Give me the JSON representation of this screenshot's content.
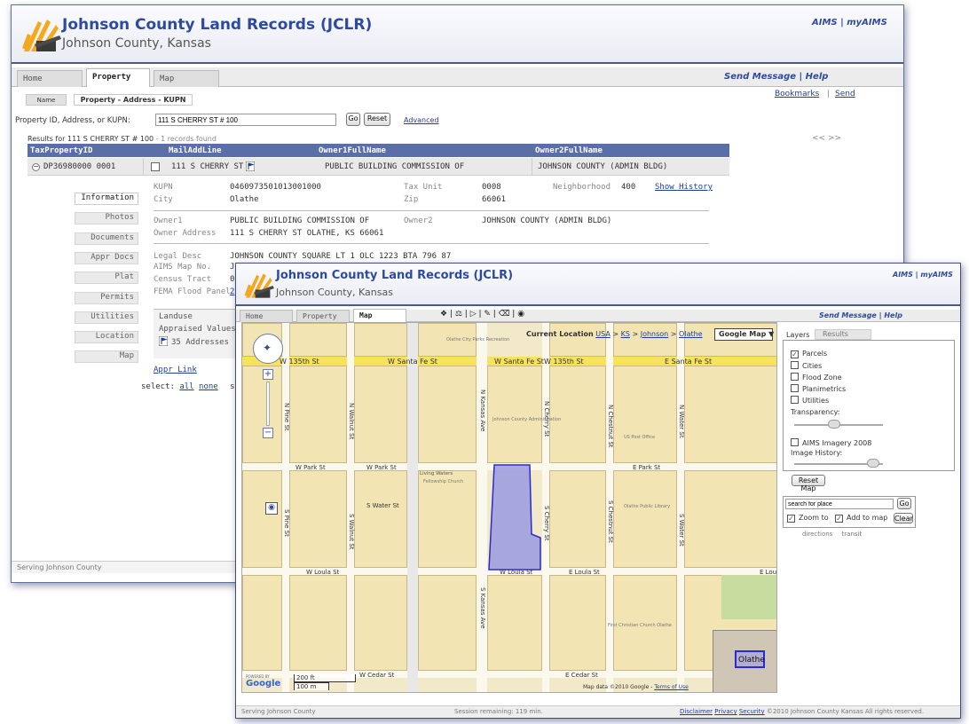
{
  "app": {
    "title": "Johnson County Land Records (JCLR)",
    "subtitle": "Johnson County, Kansas",
    "top_links": "AIMS | myAIMS"
  },
  "back_window": {
    "tabs": [
      "Home",
      "Property",
      "Map"
    ],
    "active_tab": "Property",
    "right_links": "Send Message | Help",
    "bookmarks": "Bookmarks",
    "send": "Send",
    "search_mode_name": "Name",
    "search_mode_active": "Property - Address - KUPN",
    "search_label": "Property ID, Address, or KUPN:",
    "search_value": "111 S CHERRY ST # 100",
    "go_button": "Go",
    "reset_button": "Reset",
    "advanced_link": "Advanced",
    "results_text": "Results for 111 S CHERRY ST # 100",
    "results_count": " - 1 records found",
    "pager": "<< >>",
    "columns": [
      "TaxPropertyID",
      "MailAddLine",
      "Owner1FullName",
      "Owner2FullName"
    ],
    "row": {
      "tax_id": "DP36980000 0001",
      "mail": "111 S CHERRY ST",
      "owner1": "PUBLIC BUILDING COMMISSION OF",
      "owner2": "JOHNSON COUNTY (ADMIN BLDG)"
    },
    "side_tabs": [
      "Information",
      "Photos",
      "Documents",
      "Appr Docs",
      "Plat",
      "Permits",
      "Utilities",
      "Location",
      "Map"
    ],
    "details": {
      "kupn_label": "KUPN",
      "kupn": "0460973501013001000",
      "city_label": "City",
      "city": "Olathe",
      "taxunit_label": "Tax Unit",
      "taxunit": "0008",
      "zip_label": "Zip",
      "zip": "66061",
      "neighborhood_label": "Neighborhood",
      "neighborhood": "400",
      "show_history": "Show History",
      "owner1_label": "Owner1",
      "owner1": "PUBLIC BUILDING COMMISSION OF",
      "owner2_label": "Owner2",
      "owner2": "JOHNSON COUNTY (ADMIN BLDG)",
      "owner_addr_label": "Owner Address",
      "owner_addr": "111 S CHERRY ST  OLATHE, KS 66061",
      "legal_label": "Legal Desc",
      "legal": "JOHNSON COUNTY SQUARE LT 1 OLC 1223 BTA 796 87",
      "aims_label": "AIMS Map No.",
      "aims": "J",
      "census_label": "Census Tract",
      "census": "0",
      "fema_label": "FEMA Flood Panel",
      "fema": "2",
      "landuse": "Landuse",
      "appraised": "Appraised Values",
      "addresses": "35 Addresses",
      "appr_link": "Appr Link",
      "select_label": "select:",
      "select_all": "all",
      "select_none": "none",
      "select_trail": "sel"
    },
    "footer": "Serving Johnson County"
  },
  "front_window": {
    "tabs": [
      "Home",
      "Property",
      "Map"
    ],
    "active_tab": "Map",
    "right_links": "Send Message | Help",
    "toolbar_icons": [
      "info-icon",
      "measure-icon",
      "select-icon",
      "draw-icon",
      "erase-icon",
      "camera-icon"
    ],
    "current_location_label": "Current Location",
    "breadcrumb": [
      "USA",
      "KS",
      "Johnson",
      "Olathe"
    ],
    "map_type": "Google Map ▼",
    "streets": {
      "w135": "W 135th St",
      "santa_fe_1": "W Santa Fe St",
      "santa_fe_2": "W Santa Fe St",
      "w135_2": "W 135th St",
      "e_santa_fe": "E Santa Fe St",
      "w_park_1": "W Park St",
      "w_park_2": "W Park St",
      "e_park": "E Park St",
      "s_water": "S Water St",
      "w_loula_1": "W Loula St",
      "w_loula_2": "W Loula St",
      "e_loula_1": "E Loula St",
      "e_loula_2": "E Loula",
      "w_cedar": "W Cedar St",
      "e_cedar": "E Cedar St",
      "n_pine": "N Pine St",
      "s_pine": "S Pine St",
      "n_walnut": "N Walnut St",
      "s_walnut": "S Walnut St",
      "n_kansas": "N Kansas Ave",
      "s_kansas": "S Kansas Ave",
      "n_cherry": "N Cherry St",
      "s_cherry": "S Cherry St",
      "n_chestnut": "N Chestnut St",
      "s_chestnut": "S Chestnut St",
      "n_water": "N Water St",
      "s_water_v": "S Water St"
    },
    "pois": {
      "olathe_rec": "Olathe City Parks Recreation",
      "jc_admin": "Johnson County Administration",
      "us_post": "US Post Office",
      "living_waters": "Living Waters",
      "fellowship": "Fellowship Church",
      "olathe_library": "Olathe Public Library",
      "first_christian": "First Christian Church Olathe",
      "olathe_mini": "Olathe"
    },
    "scale_ft": "200 ft",
    "scale_m": "100 m",
    "powered_by": "POWERED BY",
    "google": "Google",
    "map_data": "Map data ©2010 Google -",
    "terms": "Terms of Use",
    "layer_tabs": [
      "Layers",
      "Results"
    ],
    "layers": [
      {
        "label": "Parcels",
        "checked": true
      },
      {
        "label": "Cities",
        "checked": false
      },
      {
        "label": "Flood Zone",
        "checked": false
      },
      {
        "label": "Planimetrics",
        "checked": false
      },
      {
        "label": "Utilities",
        "checked": false
      }
    ],
    "transparency_label": "Transparency:",
    "aims_imagery": "AIMS Imagery 2008",
    "image_history": "Image History:",
    "reset_map": "Reset Map",
    "search_placeholder": "search for place",
    "search_go": "Go",
    "zoom_to": "Zoom to",
    "add_to_map": "Add to map",
    "clear": "Clear",
    "directions": "directions",
    "transit": "transit",
    "footer_left": "Serving Johnson County",
    "footer_mid": "Session remaining: 119 min.",
    "footer_links": [
      "Disclaimer",
      "Privacy",
      "Security"
    ],
    "footer_copy": "©2010 Johnson County Kansas All rights reserved."
  }
}
